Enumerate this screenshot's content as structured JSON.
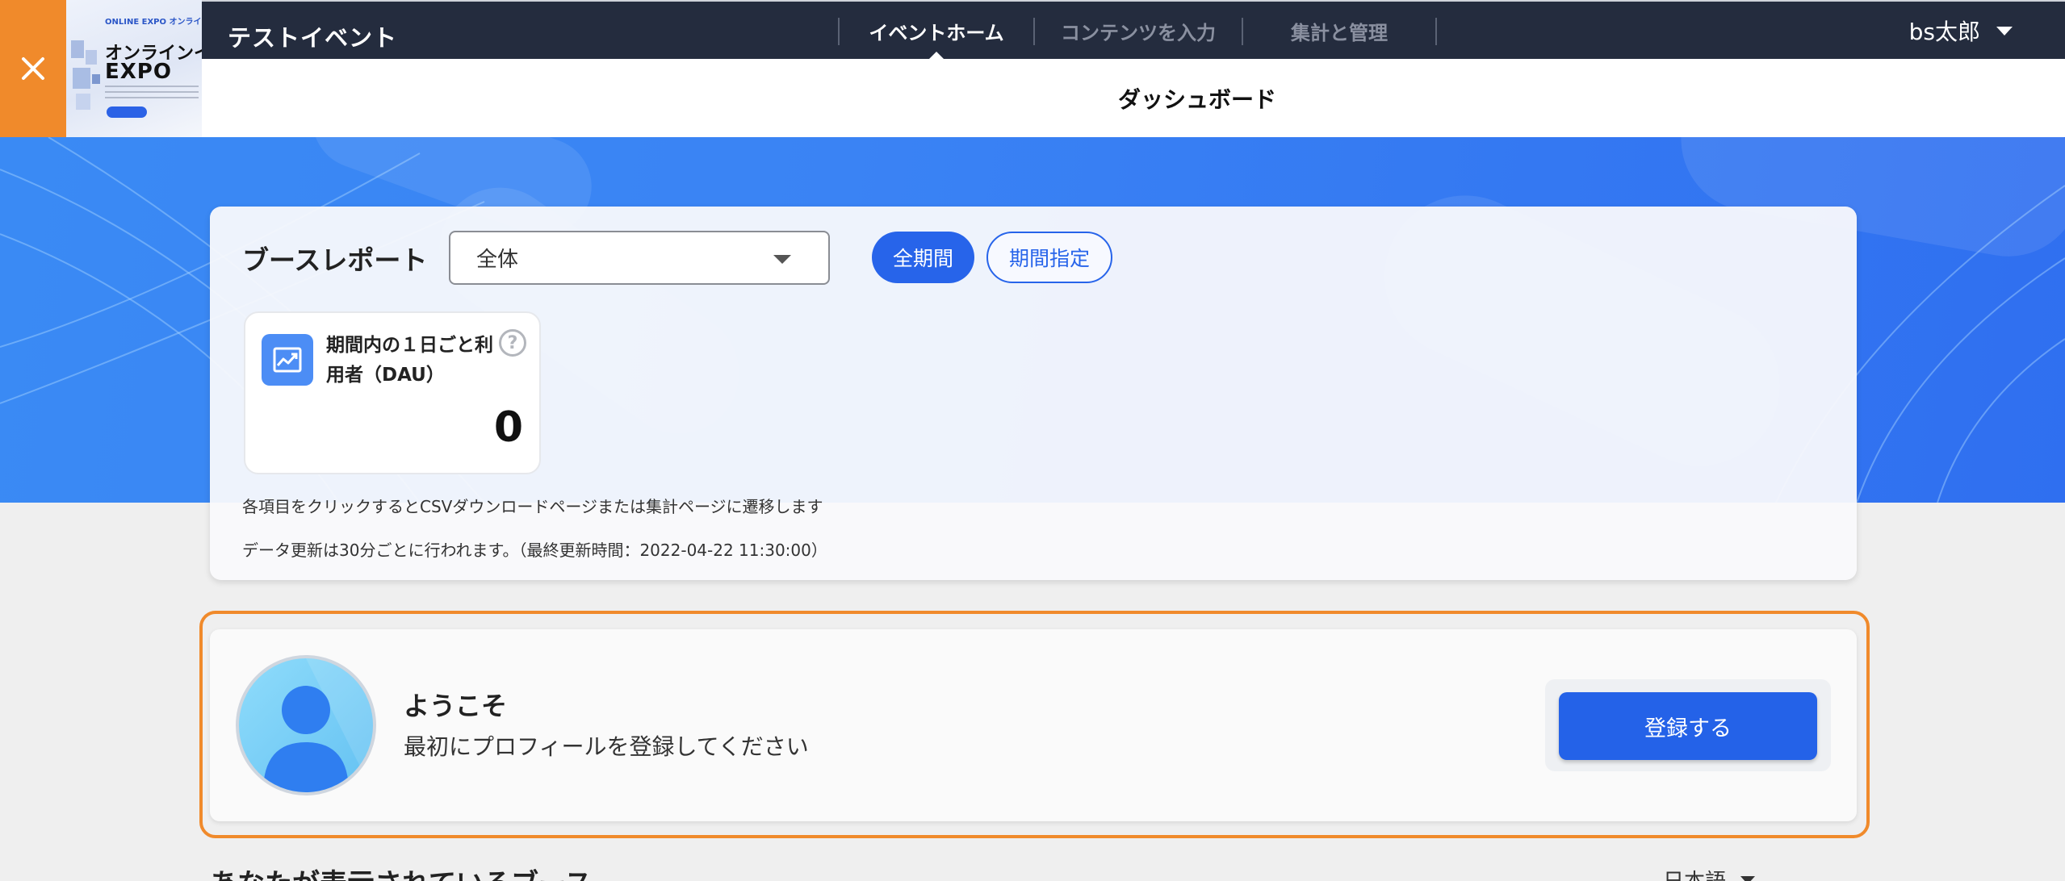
{
  "header": {
    "event_title": "テストイベント",
    "tabs": [
      {
        "label": "イベントホーム",
        "active": true
      },
      {
        "label": "コンテンツを入力",
        "active": false
      },
      {
        "label": "集計と管理",
        "active": false
      }
    ],
    "user_name": "bs太郎",
    "thumbnail": {
      "brand": "ONLINE EXPO  オンラインEXPO",
      "line1": "オンラインイ",
      "line2": "EXPO"
    }
  },
  "subheader": {
    "title": "ダッシュボード"
  },
  "report": {
    "title": "ブースレポート",
    "select_value": "全体",
    "period_all": "全期間",
    "period_custom": "期間指定",
    "metric": {
      "label": "期間内の１日ごと利用者（DAU）",
      "help": "?",
      "value": "0"
    },
    "note1": "各項目をクリックするとCSVダウンロードページまたは集計ページに遷移します",
    "note2": "データ更新は30分ごとに行われます。（最終更新時間：2022-04-22 11:30:00）"
  },
  "welcome": {
    "title": "ようこそ",
    "subtitle": "最初にプロフィールを登録してください",
    "button": "登録する"
  },
  "bottom": {
    "section_title": "あなたが表示されているブース",
    "language": "日本語"
  },
  "colors": {
    "accent": "#2764ea",
    "orange": "#f08a2b",
    "topbar": "#242c3e",
    "hero": "#3a83f4"
  }
}
